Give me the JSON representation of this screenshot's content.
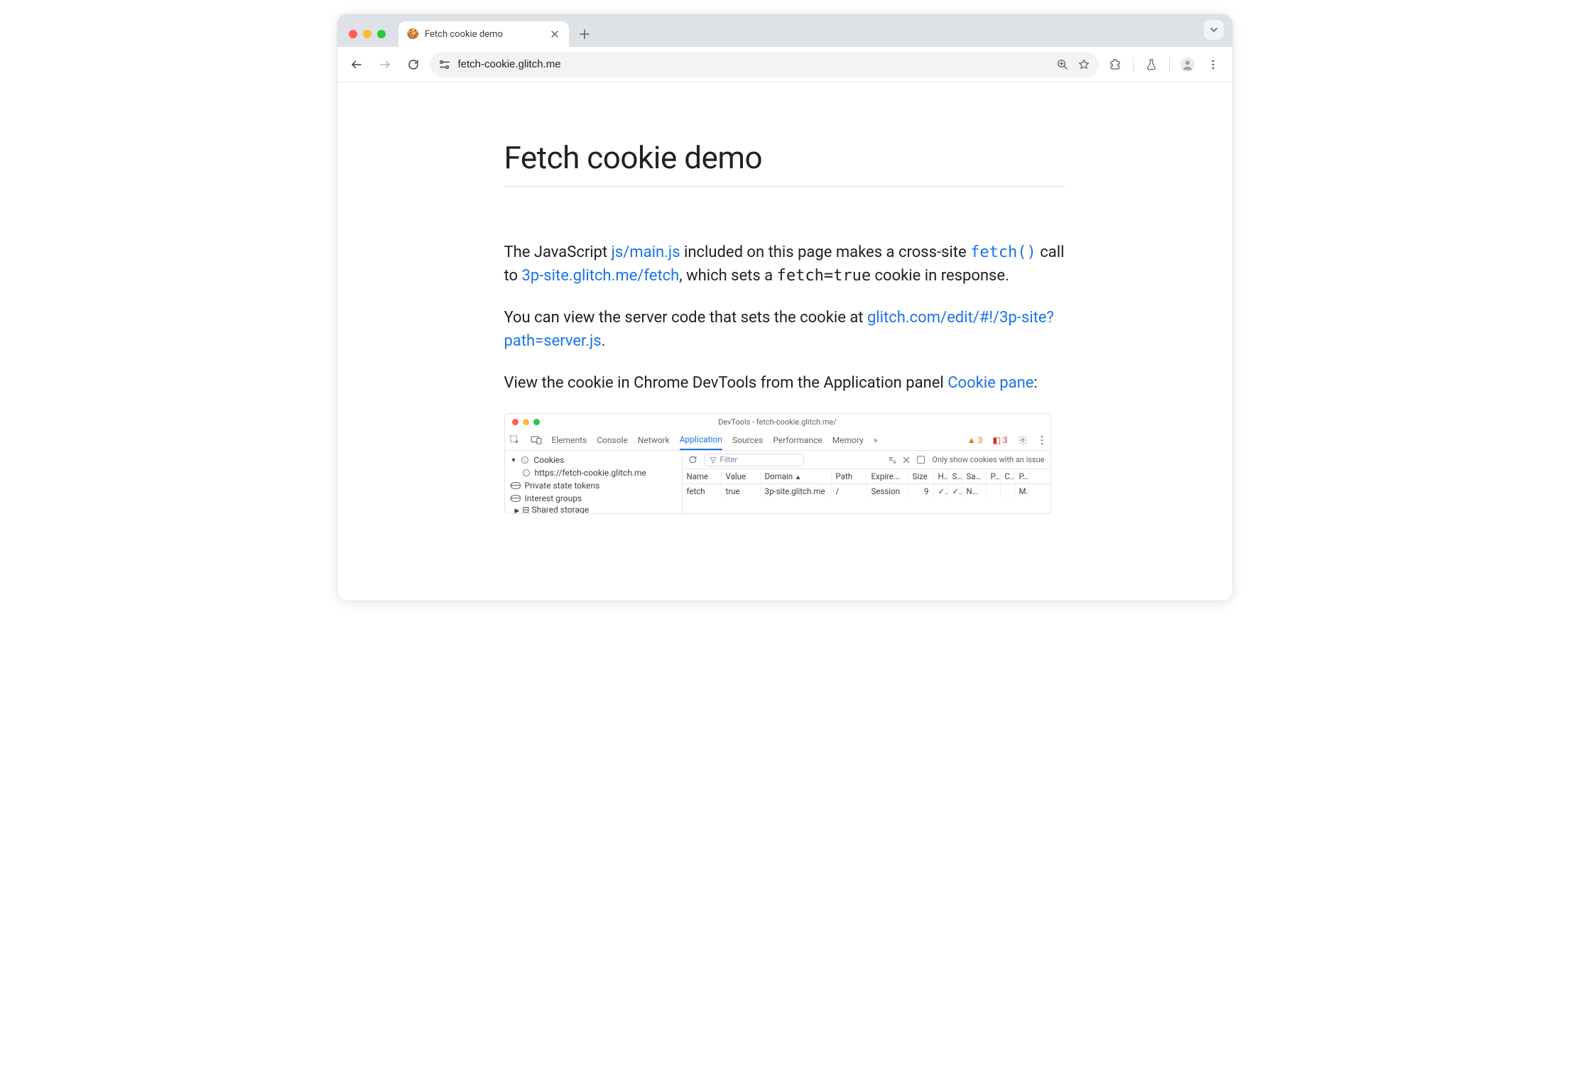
{
  "tab": {
    "favicon": "🍪",
    "title": "Fetch cookie demo"
  },
  "url": "fetch-cookie.glitch.me",
  "page": {
    "heading": "Fetch cookie demo",
    "p1_a": "The JavaScript ",
    "p1_link1": "js/main.js",
    "p1_b": " included on this page makes a cross-site ",
    "p1_code_link": "fetch()",
    "p1_c": " call to ",
    "p1_link2": "3p-site.glitch.me/fetch",
    "p1_d": ", which sets a ",
    "p1_code": "fetch=true",
    "p1_e": " cookie in response.",
    "p2_a": "You can view the server code that sets the cookie at ",
    "p2_link": "glitch.com/edit/#!/3p-site?path=server.js",
    "p2_b": ".",
    "p3_a": "View the cookie in Chrome DevTools from the Application panel ",
    "p3_link": "Cookie pane",
    "p3_b": ":"
  },
  "devtools": {
    "title": "DevTools - fetch-cookie.glitch.me/",
    "tabs": [
      "Elements",
      "Console",
      "Network",
      "Application",
      "Sources",
      "Performance",
      "Memory"
    ],
    "active_tab": "Application",
    "warn_count": "3",
    "err_count": "3",
    "side": {
      "cookies_label": "Cookies",
      "cookie_origin": "https://fetch-cookie.glitch.me",
      "pst": "Private state tokens",
      "ig": "Interest groups",
      "shared": "Shared storage"
    },
    "filter_placeholder": "Filter",
    "only_issue": "Only show cookies with an issue",
    "columns": [
      "Name",
      "Value",
      "Domain",
      "Path",
      "Expire...",
      "Size",
      "H.",
      "S.",
      "Sa...",
      "P..",
      "C.",
      "P."
    ],
    "row": {
      "name": "fetch",
      "value": "true",
      "domain": "3p-site.glitch.me",
      "path": "/",
      "expires": "Session",
      "size": "9",
      "http": "✓",
      "secure": "✓",
      "samesite": "No...",
      "pk": "",
      "cross": "",
      "pr": "M.."
    }
  }
}
